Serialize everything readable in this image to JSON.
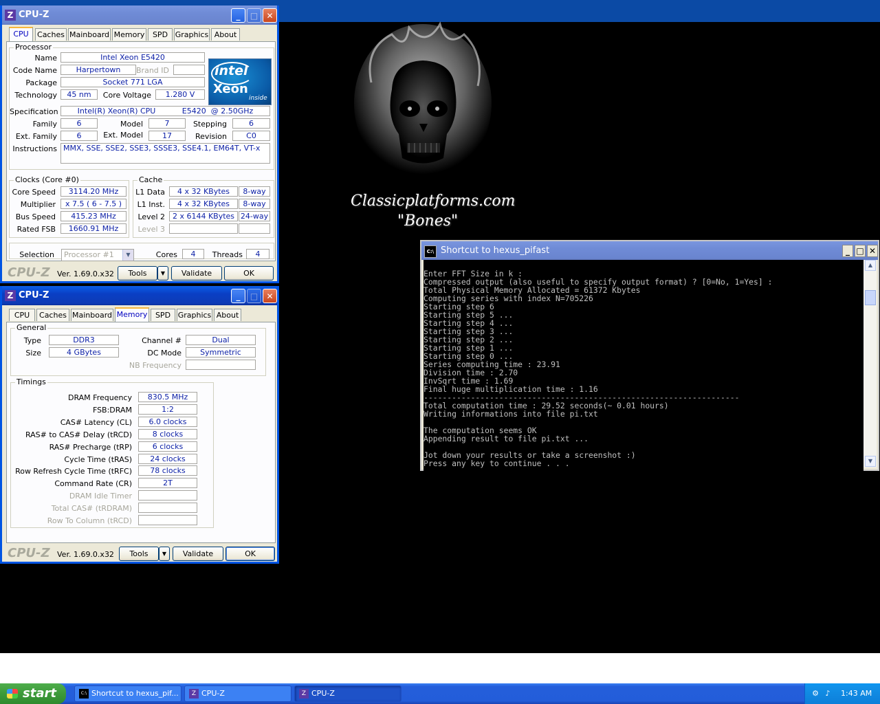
{
  "wallpaper": {
    "line1": "Classicplatforms.com",
    "line2": "\"Bones\""
  },
  "cpuz1": {
    "title": "CPU-Z",
    "tabs": [
      "CPU",
      "Caches",
      "Mainboard",
      "Memory",
      "SPD",
      "Graphics",
      "About"
    ],
    "selected_tab": "CPU",
    "processor_group": "Processor",
    "labels": {
      "name": "Name",
      "code_name": "Code Name",
      "brand_id": "Brand ID",
      "package": "Package",
      "technology": "Technology",
      "core_voltage": "Core Voltage",
      "specification": "Specification",
      "family": "Family",
      "model": "Model",
      "stepping": "Stepping",
      "ext_family": "Ext. Family",
      "ext_model": "Ext. Model",
      "revision": "Revision",
      "instructions": "Instructions"
    },
    "values": {
      "name": "Intel Xeon E5420",
      "code_name": "Harpertown",
      "package": "Socket 771 LGA",
      "technology": "45 nm",
      "core_voltage": "1.280 V",
      "specification": "Intel(R) Xeon(R) CPU           E5420  @ 2.50GHz",
      "family": "6",
      "model": "7",
      "stepping": "6",
      "ext_family": "6",
      "ext_model": "17",
      "revision": "C0",
      "instructions": "MMX, SSE, SSE2, SSE3, SSSE3, SSE4.1, EM64T, VT-x"
    },
    "logo": {
      "line1": "intel",
      "line2": "Xeon",
      "line3": "inside"
    },
    "clocks_group": "Clocks (Core #0)",
    "clocks_labels": {
      "core_speed": "Core Speed",
      "multiplier": "Multiplier",
      "bus_speed": "Bus Speed",
      "rated_fsb": "Rated FSB"
    },
    "clocks_values": {
      "core_speed": "3114.20 MHz",
      "multiplier": "x 7.5 ( 6 - 7.5 )",
      "bus_speed": "415.23 MHz",
      "rated_fsb": "1660.91 MHz"
    },
    "cache_group": "Cache",
    "cache_labels": {
      "l1d": "L1 Data",
      "l1i": "L1 Inst.",
      "l2": "Level 2",
      "l3": "Level 3"
    },
    "cache_values": {
      "l1d": "4 x 32 KBytes",
      "l1d_way": "8-way",
      "l1i": "4 x 32 KBytes",
      "l1i_way": "8-way",
      "l2": "2 x 6144 KBytes",
      "l2_way": "24-way"
    },
    "selection_label": "Selection",
    "selection_value": "Processor #1",
    "cores_label": "Cores",
    "cores_value": "4",
    "threads_label": "Threads",
    "threads_value": "4",
    "brand": "CPU-Z",
    "version": "Ver. 1.69.0.x32",
    "tools": "Tools",
    "validate": "Validate",
    "ok": "OK"
  },
  "cpuz2": {
    "title": "CPU-Z",
    "tabs": [
      "CPU",
      "Caches",
      "Mainboard",
      "Memory",
      "SPD",
      "Graphics",
      "About"
    ],
    "selected_tab": "Memory",
    "general_group": "General",
    "labels": {
      "type": "Type",
      "size": "Size",
      "channel": "Channel #",
      "dc_mode": "DC Mode",
      "nb_freq": "NB Frequency"
    },
    "values": {
      "type": "DDR3",
      "size": "4 GBytes",
      "channel": "Dual",
      "dc_mode": "Symmetric"
    },
    "timings_group": "Timings",
    "timing_labels": [
      "DRAM Frequency",
      "FSB:DRAM",
      "CAS# Latency (CL)",
      "RAS# to CAS# Delay (tRCD)",
      "RAS# Precharge (tRP)",
      "Cycle Time (tRAS)",
      "Row Refresh Cycle Time (tRFC)",
      "Command Rate (CR)",
      "DRAM Idle Timer",
      "Total CAS# (tRDRAM)",
      "Row To Column (tRCD)"
    ],
    "timing_values": [
      "830.5 MHz",
      "1:2",
      "6.0 clocks",
      "8 clocks",
      "6 clocks",
      "24 clocks",
      "78 clocks",
      "2T",
      "",
      "",
      ""
    ],
    "brand": "CPU-Z",
    "version": "Ver. 1.69.0.x32",
    "tools": "Tools",
    "validate": "Validate",
    "ok": "OK"
  },
  "console": {
    "title": "Shortcut to hexus_pifast",
    "lines": [
      "Enter FFT Size in k :",
      "Compressed output (also useful to specify output format) ? [0=No, 1=Yes] :",
      "Total Physical Memory Allocated = 61372 Kbytes",
      "Computing series with index N=705226",
      "Starting step 6",
      "Starting step 5 ...",
      "Starting step 4 ...",
      "Starting step 3 ...",
      "Starting step 2 ...",
      "Starting step 1 ...",
      "Starting step 0 ...",
      "Series computing time : 23.91",
      "Division time : 2.70",
      "InvSqrt time : 1.69",
      "Final huge multiplication time : 1.16",
      "-------------------------------------------------------------------",
      "Total computation time : 29.52 seconds(~ 0.01 hours)",
      "Writing informations into file pi.txt",
      "",
      "The computation seems OK",
      "Appending result to file pi.txt ...",
      "",
      "Jot down your results or take a screenshot :)",
      "Press any key to continue . . ."
    ]
  },
  "taskbar": {
    "start": "start",
    "tasks": [
      "Shortcut to hexus_pif...",
      "CPU-Z",
      "CPU-Z"
    ],
    "clock": "1:43 AM"
  },
  "colors": {
    "value_text": "#0a1ea6",
    "xp_blue": "#0054e3",
    "window_face": "#ece9d8"
  }
}
